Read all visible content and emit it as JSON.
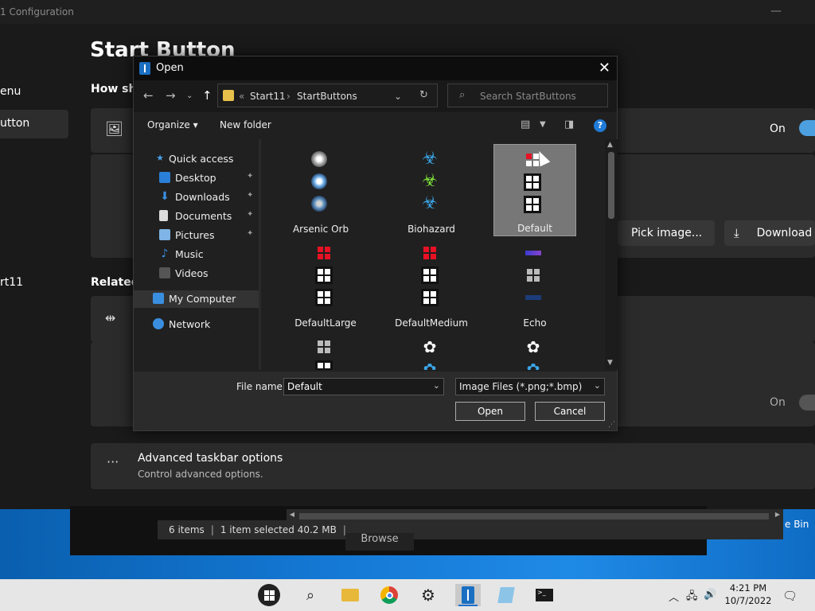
{
  "config_window": {
    "title": "1 Configuration",
    "page_title": "Start Button",
    "question": "How sho",
    "sidebar": [
      "enu",
      "utton",
      "rt11"
    ],
    "related_label": "Related",
    "toggle_top": "On",
    "toggle_bottom": "On",
    "pick_image": "Pick image...",
    "download": "Download",
    "advanced_title": "Advanced taskbar options",
    "advanced_sub": "Control advanced options."
  },
  "dialog": {
    "title": "Open",
    "breadcrumb": [
      "Start11",
      "StartButtons"
    ],
    "search_placeholder": "Search StartButtons",
    "organize": "Organize",
    "new_folder": "New folder",
    "nav": [
      {
        "label": "Quick access",
        "icon": "star-icon"
      },
      {
        "label": "Desktop",
        "icon": "desktop-icon"
      },
      {
        "label": "Downloads",
        "icon": "download-icon"
      },
      {
        "label": "Documents",
        "icon": "document-icon"
      },
      {
        "label": "Pictures",
        "icon": "picture-icon"
      },
      {
        "label": "Music",
        "icon": "music-icon"
      },
      {
        "label": "Videos",
        "icon": "video-icon"
      },
      {
        "label": "My Computer",
        "icon": "computer-icon"
      },
      {
        "label": "Network",
        "icon": "network-icon"
      }
    ],
    "files": [
      "Arsenic Orb",
      "Biohazard",
      "Default",
      "DefaultLarge",
      "DefaultMedium",
      "Echo"
    ],
    "selected_file": "Default",
    "file_name_label": "File name:",
    "file_name_value": "Default",
    "file_type": "Image Files (*.png;*.bmp)",
    "open_btn": "Open",
    "cancel_btn": "Cancel"
  },
  "explorer": {
    "items": "6 items",
    "selected": "1 item selected  40.2 MB",
    "browse": "Browse",
    "recycle": "e Bin"
  },
  "taskbar": {
    "time": "4:21 PM",
    "date": "10/7/2022"
  },
  "colors": {
    "accent": "#1f7ad8",
    "toggle_on": "#4ca0e0"
  }
}
